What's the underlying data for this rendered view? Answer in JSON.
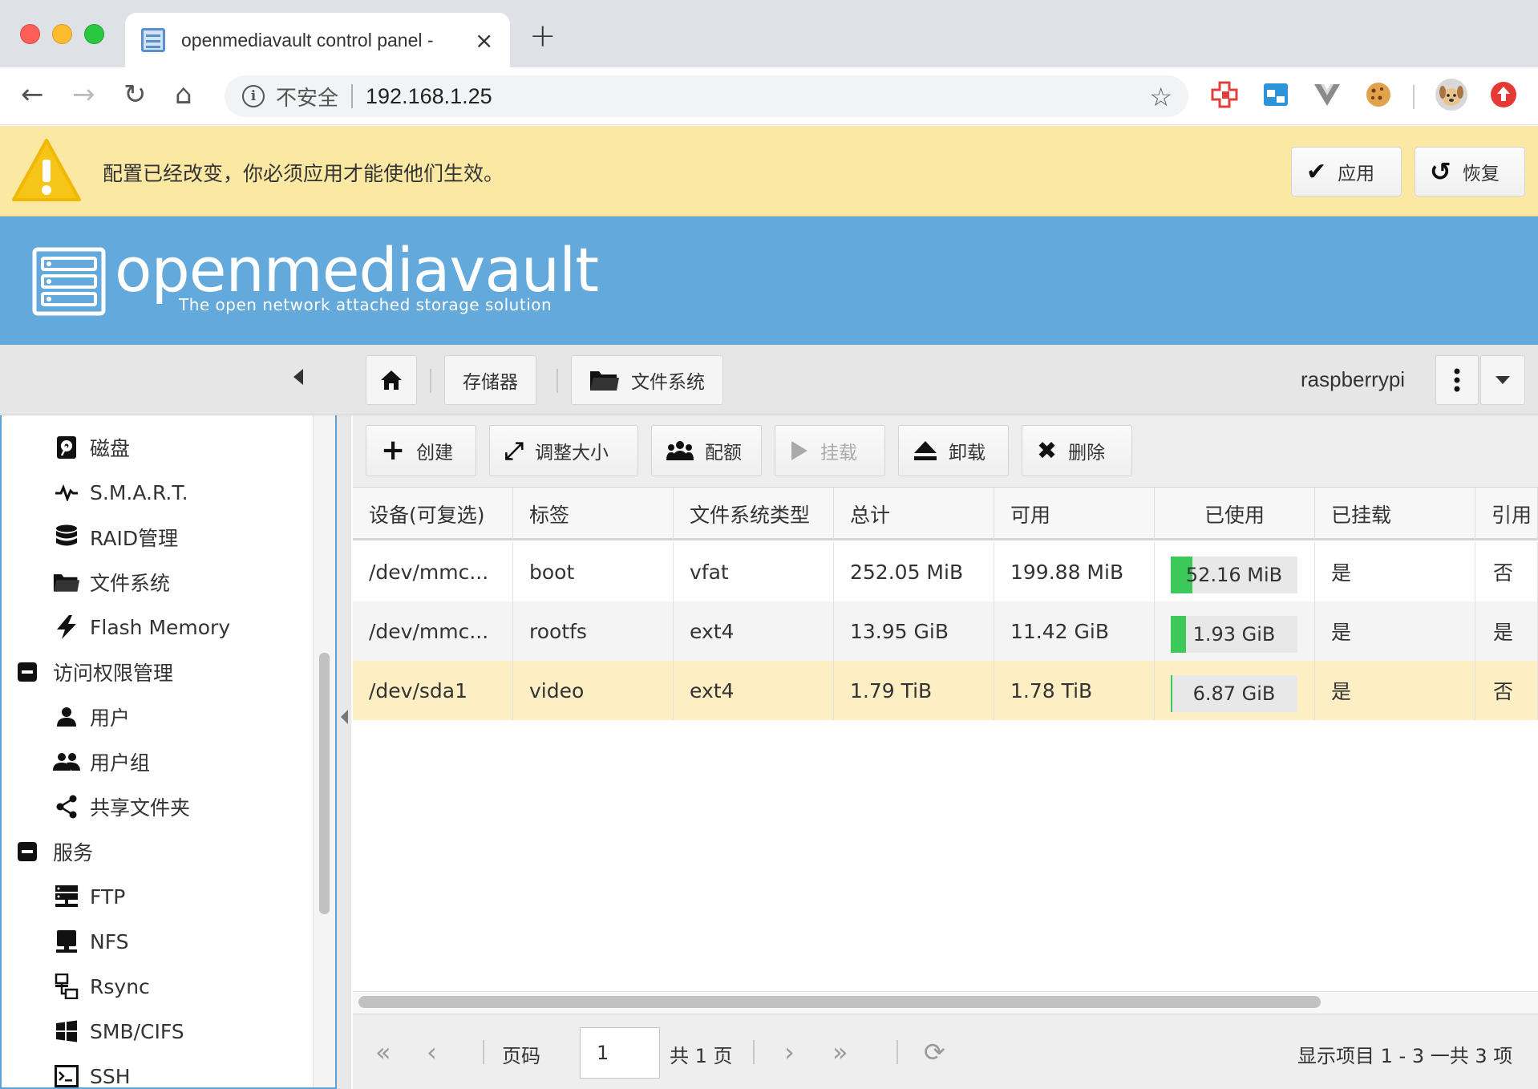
{
  "browser": {
    "tab_title": "openmediavault control panel -",
    "tab_close": "×",
    "new_tab": "+",
    "insecure_label": "不安全",
    "url": "192.168.1.25"
  },
  "banner": {
    "message": "配置已经改变，你必须应用才能使他们生效。",
    "apply_label": "应用",
    "revert_label": "恢复"
  },
  "header": {
    "logo_text": "openmediavault",
    "tagline": "The open network attached storage solution"
  },
  "breadcrumb": {
    "storage": "存储器",
    "filesystems": "文件系统",
    "hostname": "raspberrypi"
  },
  "sidebar": {
    "items": [
      {
        "label": "磁盘",
        "icon": "disk-icon"
      },
      {
        "label": "S.M.A.R.T.",
        "icon": "pulse-icon"
      },
      {
        "label": "RAID管理",
        "icon": "database-icon"
      },
      {
        "label": "文件系统",
        "icon": "folder-icon"
      },
      {
        "label": "Flash Memory",
        "icon": "flash-icon"
      },
      {
        "label": "访问权限管理",
        "icon": "collapse-icon"
      },
      {
        "label": "用户",
        "icon": "user-icon"
      },
      {
        "label": "用户组",
        "icon": "users-icon"
      },
      {
        "label": "共享文件夹",
        "icon": "share-icon"
      },
      {
        "label": "服务",
        "icon": "collapse-icon"
      },
      {
        "label": "FTP",
        "icon": "server-icon"
      },
      {
        "label": "NFS",
        "icon": "desktop-icon"
      },
      {
        "label": "Rsync",
        "icon": "network-icon"
      },
      {
        "label": "SMB/CIFS",
        "icon": "windows-icon"
      },
      {
        "label": "SSH",
        "icon": "terminal-icon"
      }
    ]
  },
  "toolbar": {
    "create": "创建",
    "resize": "调整大小",
    "quota": "配额",
    "mount": "挂载",
    "unmount": "卸载",
    "delete": "删除"
  },
  "grid": {
    "columns": [
      "设备(可复选)",
      "标签",
      "文件系统类型",
      "总计",
      "可用",
      "已使用",
      "已挂载",
      "引用"
    ],
    "rows": [
      {
        "device": "/dev/mmc...",
        "label": "boot",
        "type": "vfat",
        "total": "252.05 MiB",
        "available": "199.88 MiB",
        "used": "52.16 MiB",
        "used_fraction": 0.17,
        "mounted": "是",
        "referenced": "否"
      },
      {
        "device": "/dev/mmc...",
        "label": "rootfs",
        "type": "ext4",
        "total": "13.95 GiB",
        "available": "11.42 GiB",
        "used": "1.93 GiB",
        "used_fraction": 0.12,
        "mounted": "是",
        "referenced": "是"
      },
      {
        "device": "/dev/sda1",
        "label": "video",
        "type": "ext4",
        "total": "1.79 TiB",
        "available": "1.78 TiB",
        "used": "6.87 GiB",
        "used_fraction": 0.004,
        "mounted": "是",
        "referenced": "否"
      }
    ]
  },
  "pager": {
    "page_label": "页码",
    "page_value": "1",
    "total_pages": "共 1 页",
    "summary": "显示项目 1 - 3 一共 3 项"
  },
  "colors": {
    "header_blue": "#63a9db",
    "banner_yellow": "#fbe9a3",
    "usage_green": "#3cc95a",
    "selected_row": "#fdefc3"
  }
}
